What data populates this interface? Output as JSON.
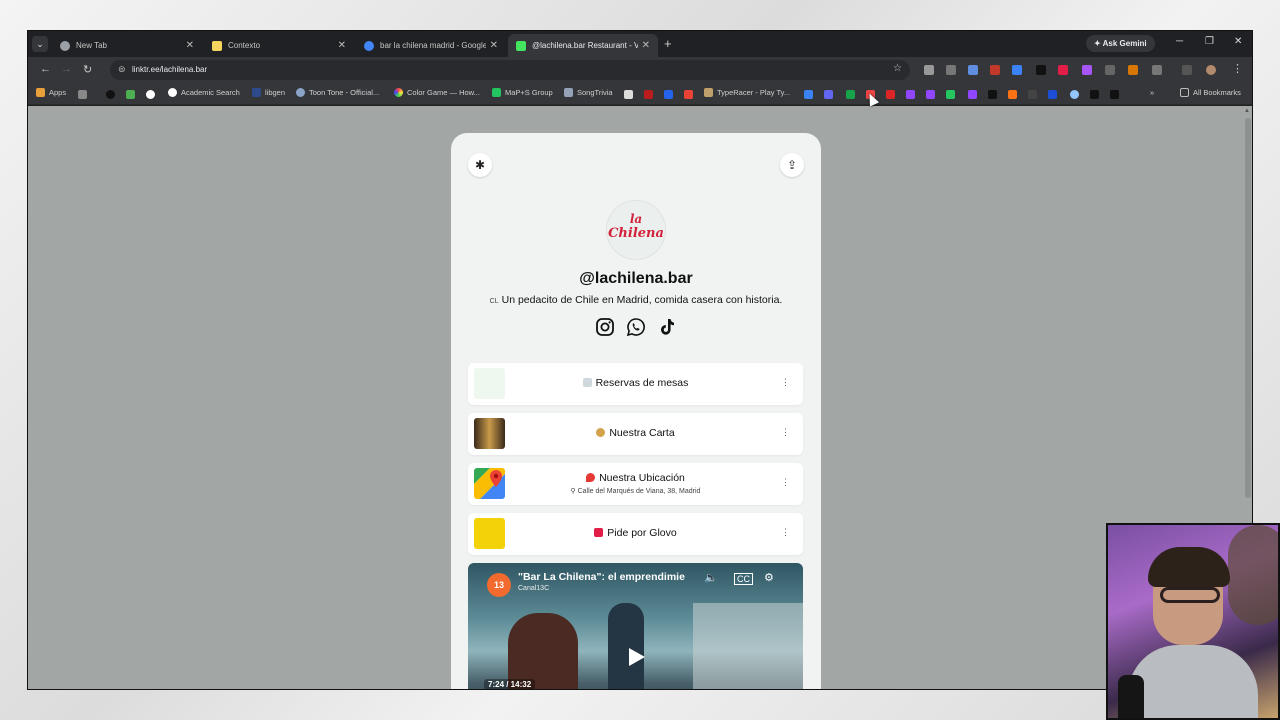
{
  "browser": {
    "tabs": [
      {
        "title": "New Tab",
        "icon": "chrome-icon",
        "color": "#9aa0a6"
      },
      {
        "title": "Contexto",
        "icon": "contexto-icon",
        "color": "#f4d35e"
      },
      {
        "title": "bar la chilena madrid - Google",
        "icon": "google-icon",
        "color": "#4285f4"
      },
      {
        "title": "@lachilena.bar Restaurant - Va",
        "icon": "linktree-icon",
        "color": "#43e55e"
      }
    ],
    "ask_gemini": "Ask Gemini",
    "url": "linktr.ee/lachilena.bar",
    "bookmarks": {
      "apps": "Apps",
      "academic": "Academic Search",
      "libgen": "libgen",
      "toon": "Toon Tone - Official...",
      "colorgame": "Color Game — How...",
      "maps": "MaP+S Group",
      "songtrivia": "SongTrivia",
      "typeracer": "TypeRacer - Play Ty...",
      "all": "All Bookmarks"
    }
  },
  "profile": {
    "logo_line1": "la",
    "logo_line2": "Chilena",
    "handle": "@lachilena.bar",
    "bio_flag": "CL",
    "bio": "Un pedacito de Chile en Madrid, comida casera con historia.",
    "socials": [
      "instagram-icon",
      "whatsapp-icon",
      "tiktok-icon"
    ]
  },
  "links": [
    {
      "label": "Reservas de mesas",
      "sub": "",
      "thumb": "whatsapp-thumb",
      "thumb_color": "#eef8ee"
    },
    {
      "label": "Nuestra Carta",
      "sub": "",
      "thumb": "food-thumb",
      "thumb_color": "#6b4a2c"
    },
    {
      "label": "Nuestra Ubicación",
      "sub": "Calle del Marqués de Viana, 38, Madrid",
      "thumb": "google-maps-thumb",
      "thumb_color": "#34a853"
    },
    {
      "label": "Pide por Glovo",
      "sub": "",
      "thumb": "glovo-thumb",
      "thumb_color": "#f4d20a"
    }
  ],
  "video": {
    "badge": "13",
    "title": "\"Bar La Chilena\": el emprendimie",
    "channel": "Canal13C",
    "time": "7:24 / 14:32"
  }
}
